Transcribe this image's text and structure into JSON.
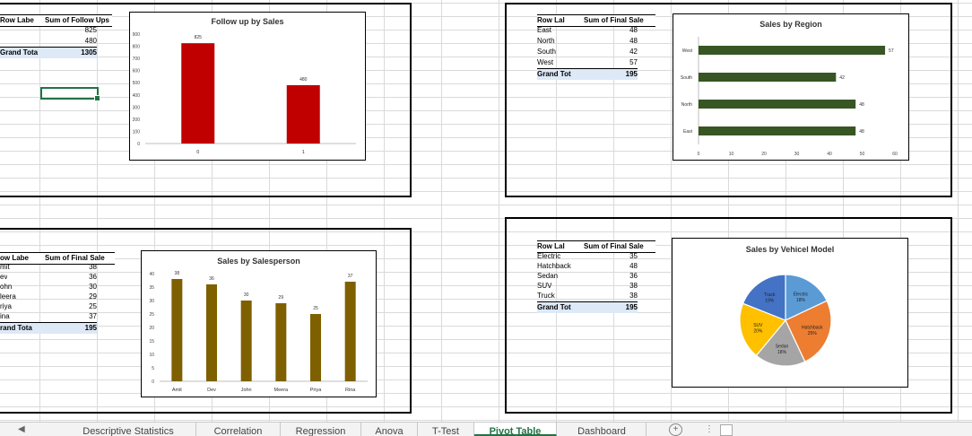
{
  "sheet": {
    "pivot1": {
      "header": [
        "Row Labe",
        "Sum of Follow Ups"
      ],
      "rows": [
        [
          "",
          "825"
        ],
        [
          "",
          "480"
        ]
      ],
      "total": [
        "Grand Tota",
        "1305"
      ]
    },
    "pivot2": {
      "header": [
        "Row Lal",
        "Sum of Final Sale"
      ],
      "rows": [
        [
          "East",
          "48"
        ],
        [
          "North",
          "48"
        ],
        [
          "South",
          "42"
        ],
        [
          "West",
          "57"
        ]
      ],
      "total": [
        "Grand Tot",
        "195"
      ]
    },
    "pivot3": {
      "header": [
        "ow Labe",
        "Sum of Final Sale"
      ],
      "rows": [
        [
          "mit",
          "38"
        ],
        [
          "ev",
          "36"
        ],
        [
          "ohn",
          "30"
        ],
        [
          "leera",
          "29"
        ],
        [
          "riya",
          "25"
        ],
        [
          "ina",
          "37"
        ]
      ],
      "total": [
        "rand Tota",
        "195"
      ]
    },
    "pivot4": {
      "header": [
        "Row Lal",
        "Sum of Final Sale"
      ],
      "rows": [
        [
          "Electric",
          "35"
        ],
        [
          "Hatchback",
          "48"
        ],
        [
          "Sedan",
          "36"
        ],
        [
          "SUV",
          "38"
        ],
        [
          "Truck",
          "38"
        ]
      ],
      "total": [
        "Grand Tot",
        "195"
      ]
    }
  },
  "chart_data": [
    {
      "type": "bar",
      "title": "Follow up by Sales",
      "categories": [
        "0",
        "1"
      ],
      "values": [
        825,
        480
      ],
      "ylim": [
        0,
        900
      ],
      "yticks": [
        "0",
        "100",
        "200",
        "300",
        "400",
        "500",
        "600",
        "700",
        "800",
        "900"
      ],
      "color": "#c00000",
      "data_labels": [
        "825",
        "480"
      ],
      "grid": false
    },
    {
      "type": "bar",
      "orientation": "horizontal",
      "title": "Sales by Region",
      "categories": [
        "East",
        "North",
        "South",
        "West"
      ],
      "values": [
        48,
        48,
        42,
        57
      ],
      "xlim": [
        0,
        60
      ],
      "xticks": [
        "0",
        "10",
        "20",
        "30",
        "40",
        "50",
        "60"
      ],
      "color": "#375623",
      "data_labels": [
        "48",
        "48",
        "42",
        "57"
      ],
      "grid": false
    },
    {
      "type": "bar",
      "title": "Sales by Salesperson",
      "categories": [
        "Amit",
        "Dev",
        "John",
        "Meera",
        "Priya",
        "Rina"
      ],
      "values": [
        38,
        36,
        30,
        29,
        25,
        37
      ],
      "ylim": [
        0,
        40
      ],
      "yticks": [
        "0",
        "5",
        "10",
        "15",
        "20",
        "25",
        "30",
        "35",
        "40"
      ],
      "color": "#7f6000",
      "data_labels": [
        "38",
        "36",
        "30",
        "29",
        "25",
        "37"
      ],
      "grid": false
    },
    {
      "type": "pie",
      "title": "Sales by Vehicel Model",
      "categories": [
        "Electric",
        "Hatchback",
        "Sedan",
        "SUV",
        "Truck"
      ],
      "values": [
        18,
        25,
        18,
        20,
        19
      ],
      "labels": [
        [
          "Electric",
          "18%"
        ],
        [
          "Hatchback",
          "25%"
        ],
        [
          "Sedan",
          "18%"
        ],
        [
          "SUV",
          "20%"
        ],
        [
          "Truck",
          "19%"
        ]
      ],
      "colors": [
        "#5b9bd5",
        "#ed7d31",
        "#a5a5a5",
        "#ffc000",
        "#4472c4"
      ]
    }
  ],
  "tabs": {
    "items": [
      "Descriptive Statistics",
      "Correlation",
      "Regression",
      "Anova",
      "T-Test",
      "Pivot Table",
      "Dashboard"
    ],
    "active": "Pivot Table",
    "add_glyph": "+",
    "more_glyph": "⋮"
  }
}
